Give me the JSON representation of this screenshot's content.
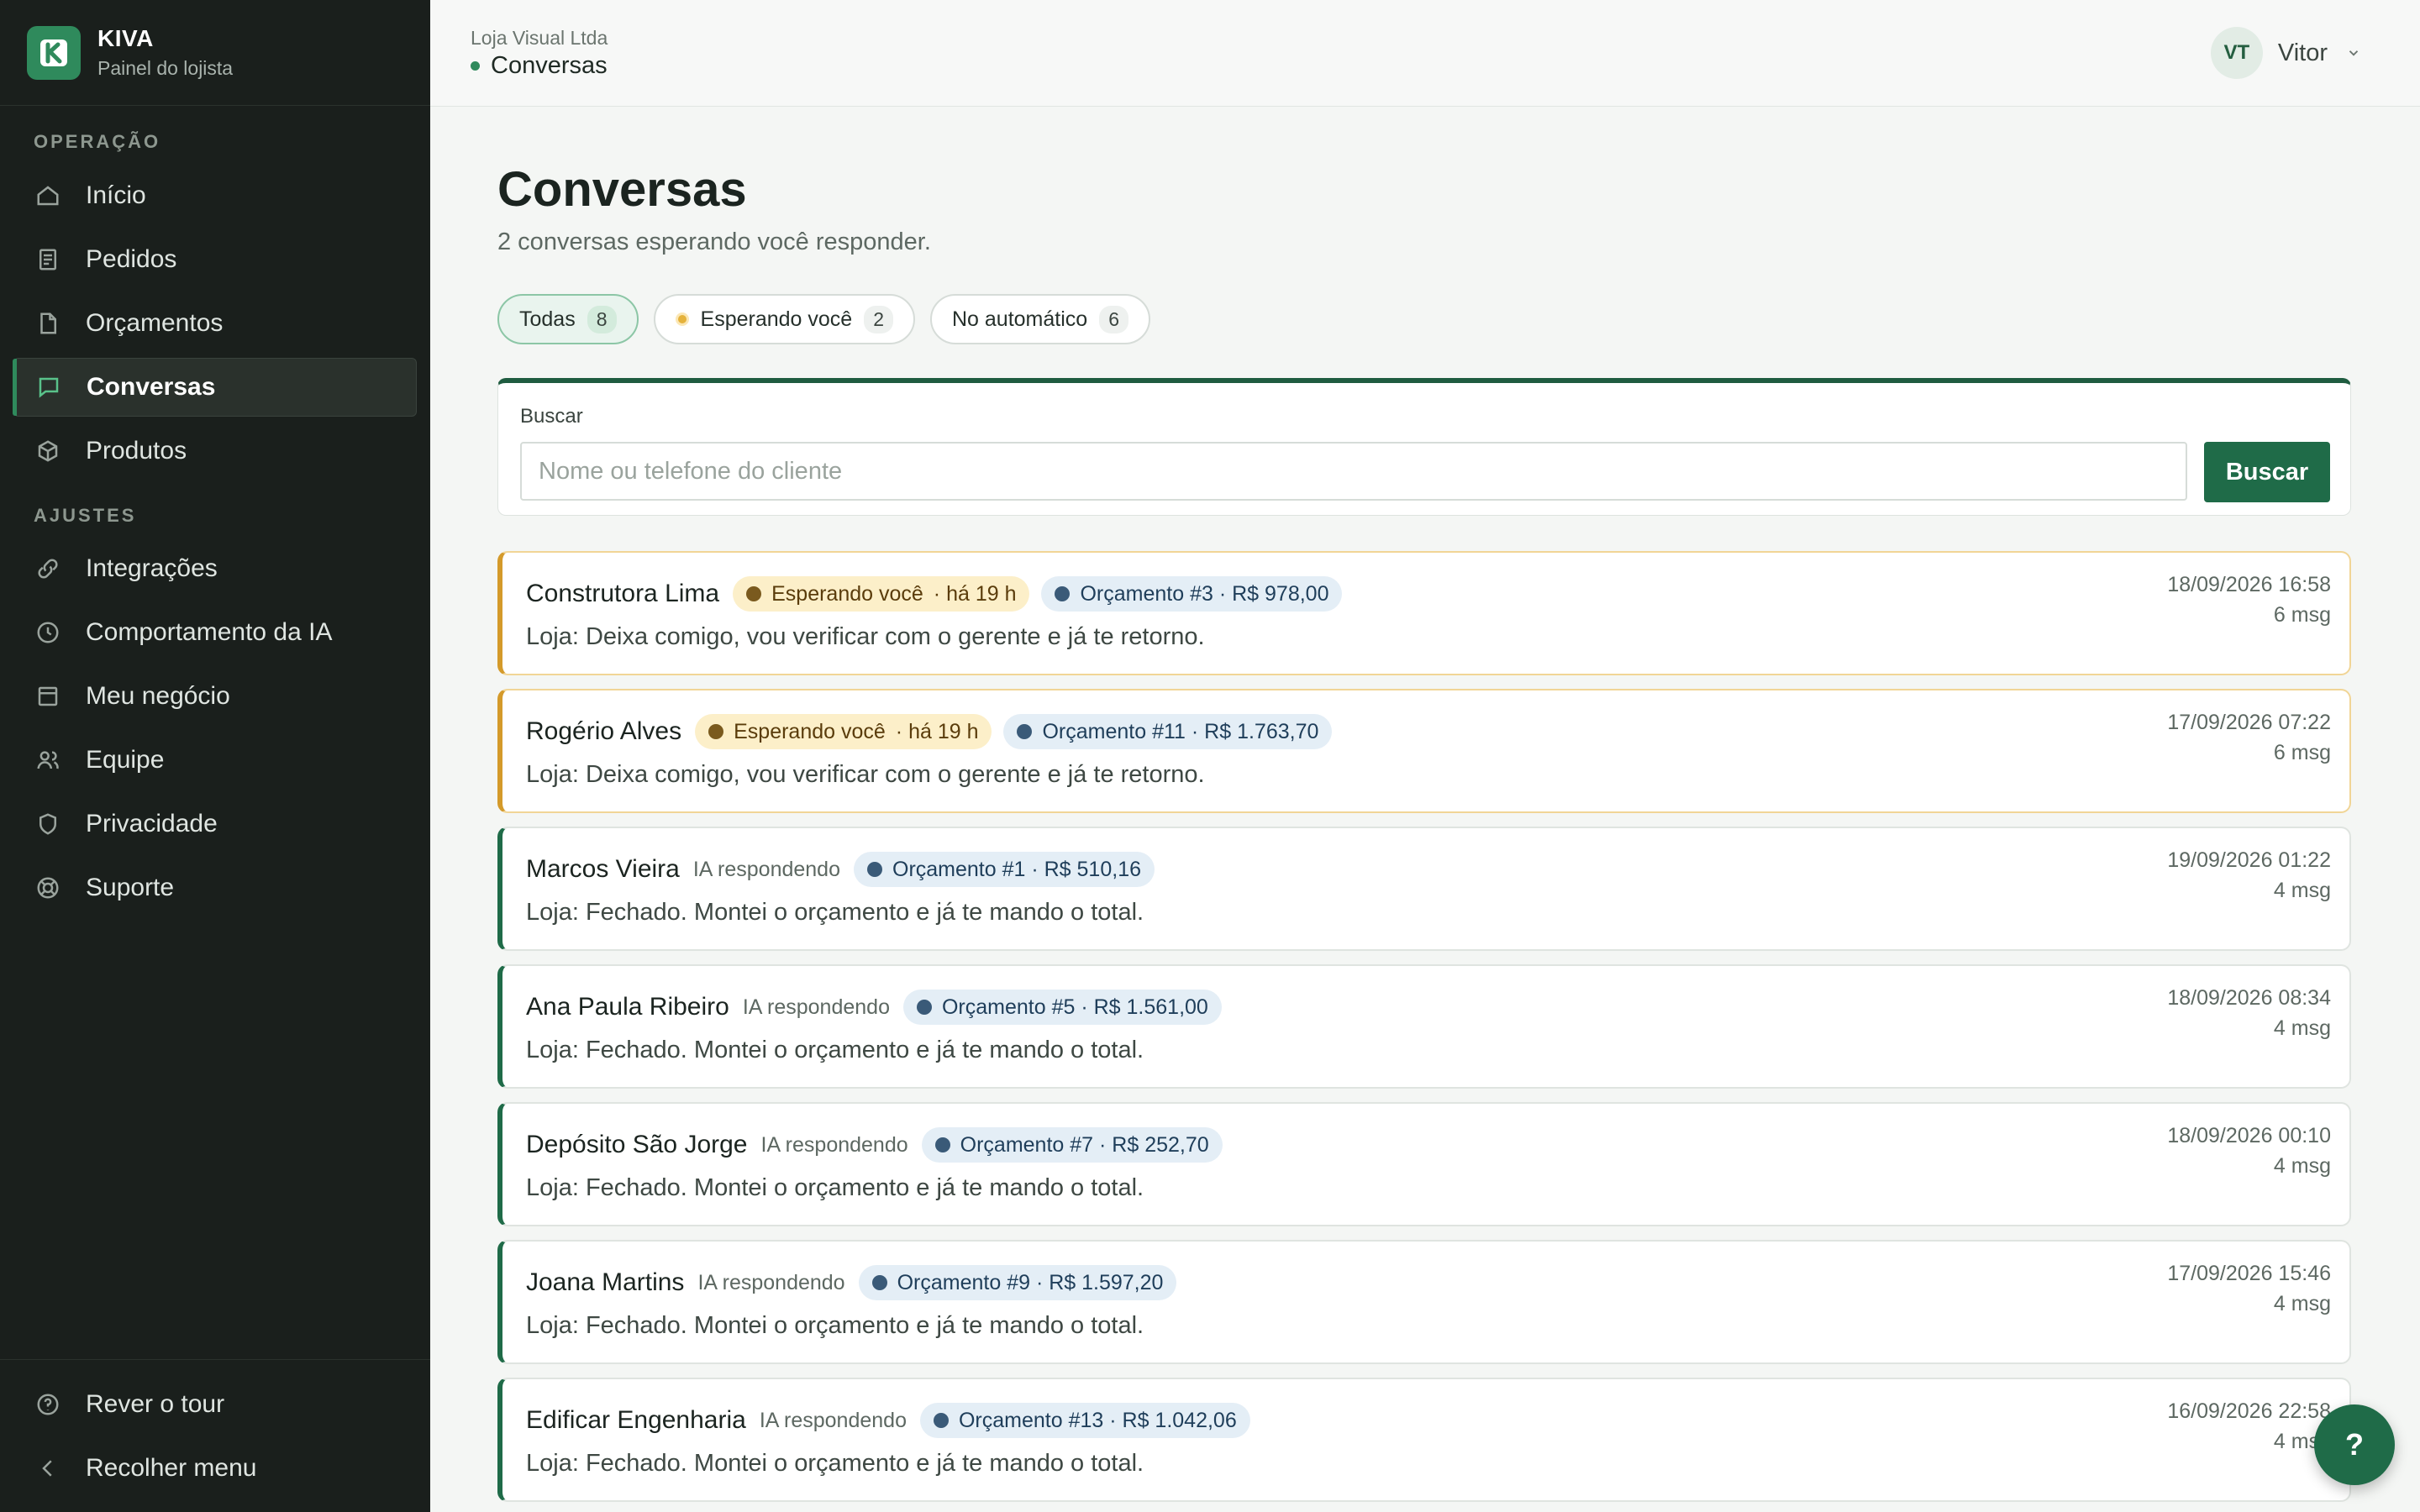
{
  "brand": {
    "name": "KIVA",
    "subtitle": "Painel do lojista",
    "logo_letter": "K"
  },
  "sidebar": {
    "section_operacao": "OPERAÇÃO",
    "section_ajustes": "AJUSTES",
    "items": [
      {
        "label": "Início",
        "icon": "home-icon"
      },
      {
        "label": "Pedidos",
        "icon": "receipt-icon"
      },
      {
        "label": "Orçamentos",
        "icon": "file-icon"
      },
      {
        "label": "Conversas",
        "icon": "chat-icon",
        "active": true
      },
      {
        "label": "Produtos",
        "icon": "box-icon"
      },
      {
        "label": "Integrações",
        "icon": "link-icon"
      },
      {
        "label": "Comportamento da IA",
        "icon": "clock-icon"
      },
      {
        "label": "Meu negócio",
        "icon": "store-icon"
      },
      {
        "label": "Equipe",
        "icon": "users-icon"
      },
      {
        "label": "Privacidade",
        "icon": "shield-icon"
      },
      {
        "label": "Suporte",
        "icon": "lifebuoy-icon"
      }
    ],
    "footer": [
      {
        "label": "Rever o tour",
        "icon": "help-circle-icon"
      },
      {
        "label": "Recolher menu",
        "icon": "chevron-left-icon"
      }
    ]
  },
  "topbar": {
    "store": "Loja Visual Ltda",
    "crumb": "Conversas",
    "user_initials": "VT",
    "user_name": "Vitor"
  },
  "page": {
    "title": "Conversas",
    "subtitle": "2 conversas esperando você responder."
  },
  "filters": [
    {
      "label": "Todas",
      "count": "8",
      "active": true
    },
    {
      "label": "Esperando você",
      "count": "2"
    },
    {
      "label": "No automático",
      "count": "6"
    }
  ],
  "search": {
    "label": "Buscar",
    "placeholder": "Nome ou telefone do cliente",
    "button": "Buscar"
  },
  "conversations": [
    {
      "name": "Construtora Lima",
      "status": "Esperando você",
      "ago": "· há 19 h",
      "quote": "Orçamento #3 · R$ 978,00",
      "message": "Loja: Deixa comigo, vou verificar com o gerente e já te retorno.",
      "date": "18/09/2026 16:58",
      "count": "6 msg"
    },
    {
      "name": "Rogério Alves",
      "status": "Esperando você",
      "ago": "· há 19 h",
      "quote": "Orçamento #11 · R$ 1.763,70",
      "message": "Loja: Deixa comigo, vou verificar com o gerente e já te retorno.",
      "date": "17/09/2026 07:22",
      "count": "6 msg"
    },
    {
      "name": "Marcos Vieira",
      "status": "IA respondendo",
      "quote": "Orçamento #1 · R$ 510,16",
      "message": "Loja: Fechado. Montei o orçamento e já te mando o total.",
      "date": "19/09/2026 01:22",
      "count": "4 msg"
    },
    {
      "name": "Ana Paula Ribeiro",
      "status": "IA respondendo",
      "quote": "Orçamento #5 · R$ 1.561,00",
      "message": "Loja: Fechado. Montei o orçamento e já te mando o total.",
      "date": "18/09/2026 08:34",
      "count": "4 msg"
    },
    {
      "name": "Depósito São Jorge",
      "status": "IA respondendo",
      "quote": "Orçamento #7 · R$ 252,70",
      "message": "Loja: Fechado. Montei o orçamento e já te mando o total.",
      "date": "18/09/2026 00:10",
      "count": "4 msg"
    },
    {
      "name": "Joana Martins",
      "status": "IA respondendo",
      "quote": "Orçamento #9 · R$ 1.597,20",
      "message": "Loja: Fechado. Montei o orçamento e já te mando o total.",
      "date": "17/09/2026 15:46",
      "count": "4 msg"
    },
    {
      "name": "Edificar Engenharia",
      "status": "IA respondendo",
      "quote": "Orçamento #13 · R$ 1.042,06",
      "message": "Loja: Fechado. Montei o orçamento e já te mando o total.",
      "date": "16/09/2026 22:58",
      "count": "4 msg"
    }
  ],
  "help_fab": "?",
  "colors": {
    "accent": "#1f6b48",
    "sidebar_bg": "#1a1f1c",
    "waiting": "#d49a2a"
  }
}
